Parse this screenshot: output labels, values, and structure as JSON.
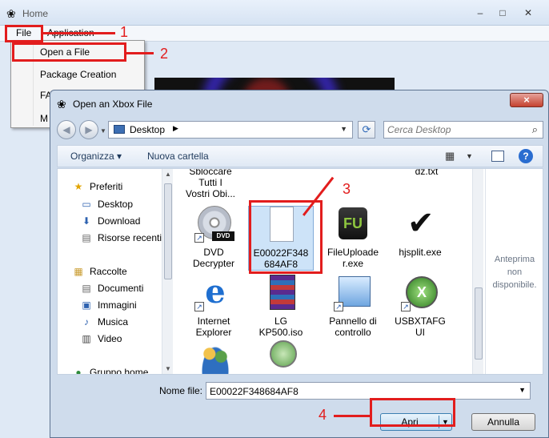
{
  "main_window": {
    "title": "Home",
    "menu": {
      "file": "File",
      "application": "Application"
    }
  },
  "file_menu": {
    "items": [
      "Open a File",
      "Package Creation",
      "FA",
      "M"
    ]
  },
  "annotations": [
    "1",
    "2",
    "3",
    "4"
  ],
  "dialog": {
    "title": "Open an Xbox File",
    "close_glyph": "×",
    "location": "Desktop",
    "search_placeholder": "Cerca Desktop",
    "toolbar": {
      "organize": "Organizza ▾",
      "new_folder": "Nuova cartella"
    },
    "nav": [
      {
        "icon": "star-icon",
        "glyph": "★",
        "label": "Preferiti"
      },
      {
        "icon": "desktop-icon",
        "glyph": "▭",
        "label": "Desktop"
      },
      {
        "icon": "download-icon",
        "glyph": "⬇",
        "label": "Download"
      },
      {
        "icon": "recent-icon",
        "glyph": "▤",
        "label": "Risorse recenti"
      },
      {
        "icon": "library-icon",
        "glyph": "▦",
        "label": "Raccolte"
      },
      {
        "icon": "documents-icon",
        "glyph": "▤",
        "label": "Documenti"
      },
      {
        "icon": "images-icon",
        "glyph": "▣",
        "label": "Immagini"
      },
      {
        "icon": "music-icon",
        "glyph": "♪",
        "label": "Musica"
      },
      {
        "icon": "video-icon",
        "glyph": "▥",
        "label": "Video"
      },
      {
        "icon": "homegroup-icon",
        "glyph": "●",
        "label": "Gruppo home"
      }
    ],
    "files": [
      {
        "name": "Sbloccare Tutti I Vostri Obi..."
      },
      {
        "name": "dz.txt"
      },
      {
        "name": "DVD Decrypter"
      },
      {
        "name": "E00022F348684AF8"
      },
      {
        "name": "FileUploader.exe"
      },
      {
        "name": "hjsplit.exe"
      },
      {
        "name": "Internet Explorer"
      },
      {
        "name": "LG KP500.iso"
      },
      {
        "name": "Pannello di controllo"
      },
      {
        "name": "USBXTAFGUI"
      }
    ],
    "file_lines": {
      "sbloccare": [
        "Sbloccare",
        "Tutti I",
        "Vostri Obi..."
      ],
      "dvd": [
        "DVD",
        "Decrypter"
      ],
      "e000": [
        "E00022F348",
        "684AF8"
      ],
      "fu": [
        "FileUploade",
        "r.exe"
      ],
      "hj": [
        "hjsplit.exe"
      ],
      "ie": [
        "Internet",
        "Explorer"
      ],
      "lg": [
        "LG",
        "KP500.iso"
      ],
      "pannello": [
        "Pannello di",
        "controllo"
      ],
      "usb": [
        "USBXTAFG",
        "UI"
      ]
    },
    "preview_text": [
      "Anteprima",
      "non",
      "disponibile."
    ],
    "filename_label": "Nome file:",
    "filename_value": "E00022F348684AF8",
    "open_button": "Apri",
    "cancel_button": "Annulla"
  }
}
